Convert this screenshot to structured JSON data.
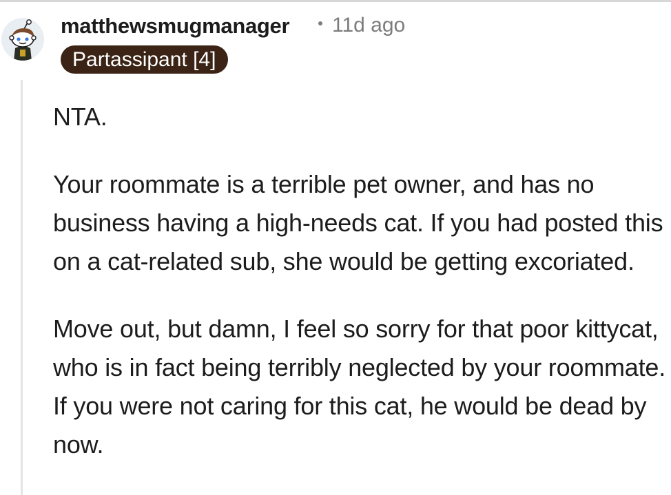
{
  "comment": {
    "author": "matthewsmugmanager",
    "timestamp": "11d ago",
    "flair": "Partassipant [4]",
    "paragraphs": [
      "NTA.",
      "Your roommate is a terrible pet owner, and has no business having a high-needs cat. If you had posted this on a cat-related sub, she would be getting excoriated.",
      "Move out, but damn, I feel so sorry for that poor kittycat, who is in fact being terribly neglected by your roommate. If you were not caring for this cat, he would be dead by now."
    ]
  },
  "icons": {
    "avatar": "snoo-avatar-icon",
    "separator": "dot-separator-icon"
  },
  "colors": {
    "flair_background": "#3b2415",
    "meta_text": "#7c7c7c",
    "body_text": "#1c1c1c",
    "thread_line": "#e4e4e4"
  }
}
